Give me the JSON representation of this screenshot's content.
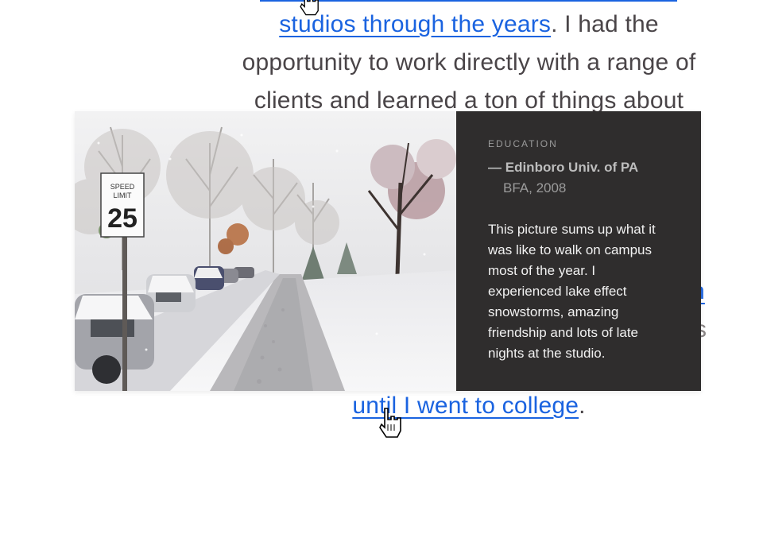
{
  "paragraph": {
    "line1_link": "studios through the years",
    "line1_text": ". I had the",
    "line2": "opportunity to work directly with a range of",
    "line3": "clients and learned a ton of things about",
    "hidden_link_fragment": "n",
    "hidden_text_fragment": "s",
    "line_last_link": "until I went to college",
    "line_last_text": "."
  },
  "card": {
    "eyebrow": "EDUCATION",
    "school": "Edinboro Univ. of PA",
    "dash": "—",
    "degree": "BFA, 2008",
    "description": "This picture sums up what it was like to walk on campus most of the year. I experienced lake effect snowstorms, amazing friendship and lots of late nights at the studio.",
    "photo": {
      "sign_text_top": "SPEED LIMIT",
      "sign_number": "25"
    }
  },
  "colors": {
    "link": "#1a63e0",
    "body_text": "#4a4548",
    "card_bg": "#2f2d2d"
  },
  "icons": {
    "cursor": "hand-pointer-icon"
  }
}
